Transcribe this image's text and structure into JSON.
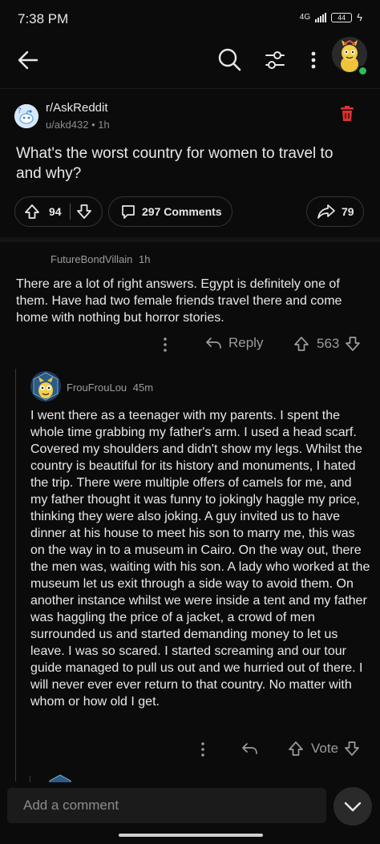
{
  "status_bar": {
    "time": "7:38 PM",
    "network": "4G",
    "battery": "44"
  },
  "nav": {
    "icons": [
      "back-arrow-icon",
      "search-icon",
      "filter-icon",
      "more-vertical-icon",
      "avatar"
    ]
  },
  "post": {
    "subreddit": "r/AskReddit",
    "author": "u/akd432",
    "time_ago": "1h",
    "title": "What's the worst country for women to travel to and why?",
    "score": "94",
    "comments_label": "297 Comments",
    "shares": "79"
  },
  "comments": [
    {
      "author": "FutureBondVillain",
      "time_ago": "1h",
      "body": "There are a lot of right answers. Egypt is definitely one of them. Have had two female friends travel there and come home with nothing but horror stories.",
      "reply_label": "Reply",
      "score": "563"
    },
    {
      "author": "FrouFrouLou",
      "time_ago": "45m",
      "body": "I went there as a teenager with my parents. I spent the whole time grabbing my father's arm. I used a head scarf. Covered my shoulders and didn't show my legs. Whilst the country is beautiful for its history and monuments, I hated the trip. There were multiple offers of camels for me, and my father thought it was funny to jokingly haggle my price, thinking they were also joking. A guy invited us to have dinner at his house to meet his son to marry me, this was on the way in to a museum in Cairo. On the way out, there the men was, waiting with his son. A lady who worked at the museum let us exit through a side way to avoid them. On another instance whilst we were inside a tent and my father was haggling the price of a jacket, a crowd of men surrounded us and started demanding money to let us leave. I was so scared. I started screaming and our tour guide managed to pull us out and we hurried out of there. I will never ever ever return to that country. No matter with whom or how old I get.",
      "vote_label": "Vote"
    }
  ],
  "composer": {
    "placeholder": "Add a comment"
  },
  "colors": {
    "background": "#0b0b0b",
    "delete": "#e03131",
    "online": "#2ebd59"
  }
}
